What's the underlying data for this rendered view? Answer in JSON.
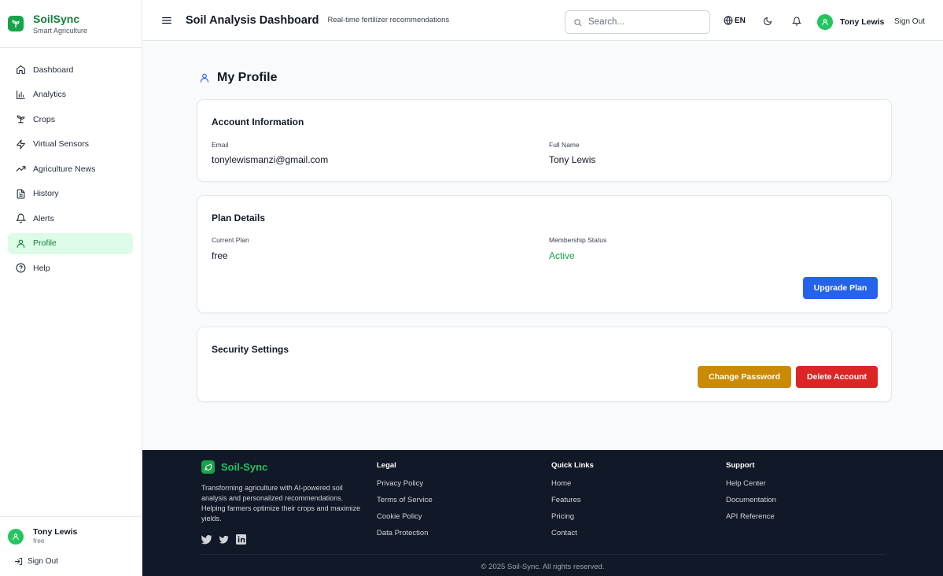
{
  "colors": {
    "brand_green": "#16a34a",
    "sidebar_active_bg": "#dcfce7",
    "primary_blue": "#2563eb",
    "warning_amber": "#ca8a04",
    "danger_red": "#dc2626",
    "footer_bg": "#111827"
  },
  "sidebar": {
    "brand_name": "SoilSync",
    "brand_tagline": "Smart Agriculture",
    "items": [
      {
        "label": "Dashboard",
        "icon": "home-icon"
      },
      {
        "label": "Analytics",
        "icon": "bar-chart-icon"
      },
      {
        "label": "Crops",
        "icon": "sprout-icon"
      },
      {
        "label": "Virtual Sensors",
        "icon": "zap-icon"
      },
      {
        "label": "Agriculture News",
        "icon": "trending-up-icon"
      },
      {
        "label": "History",
        "icon": "file-text-icon"
      },
      {
        "label": "Alerts",
        "icon": "bell-icon"
      },
      {
        "label": "Profile",
        "icon": "user-icon",
        "active": true
      },
      {
        "label": "Help",
        "icon": "help-circle-icon"
      }
    ],
    "user": {
      "name": "Tony Lewis",
      "plan": "free"
    },
    "sign_out": "Sign Out"
  },
  "header": {
    "title": "Soil Analysis Dashboard",
    "subtitle": "Real-time fertilizer recommendations",
    "search_placeholder": "Search...",
    "language": "EN",
    "user_name": "Tony Lewis",
    "sign_out": "Sign Out"
  },
  "profile": {
    "title": "My Profile",
    "account": {
      "heading": "Account Information",
      "email_label": "Email",
      "email": "tonylewismanzi@gmail.com",
      "name_label": "Full Name",
      "name": "Tony Lewis"
    },
    "plan": {
      "heading": "Plan Details",
      "plan_label": "Current Plan",
      "plan": "free",
      "status_label": "Membership Status",
      "status": "Active",
      "upgrade_button": "Upgrade Plan"
    },
    "security": {
      "heading": "Security Settings",
      "change_password_button": "Change Password",
      "delete_account_button": "Delete Account"
    }
  },
  "footer": {
    "brand_name": "Soil-Sync",
    "description": "Transforming agriculture with AI-powered soil analysis and personalized recommendations. Helping farmers optimize their crops and maximize yields.",
    "social": [
      "twitter-icon",
      "twitter-icon",
      "linkedin-icon"
    ],
    "columns": [
      {
        "heading": "Legal",
        "links": [
          "Privacy Policy",
          "Terms of Service",
          "Cookie Policy",
          "Data Protection"
        ]
      },
      {
        "heading": "Quick Links",
        "links": [
          "Home",
          "Features",
          "Pricing",
          "Contact"
        ]
      },
      {
        "heading": "Support",
        "links": [
          "Help Center",
          "Documentation",
          "API Reference"
        ]
      }
    ],
    "copyright": "© 2025 Soil-Sync. All rights reserved."
  }
}
